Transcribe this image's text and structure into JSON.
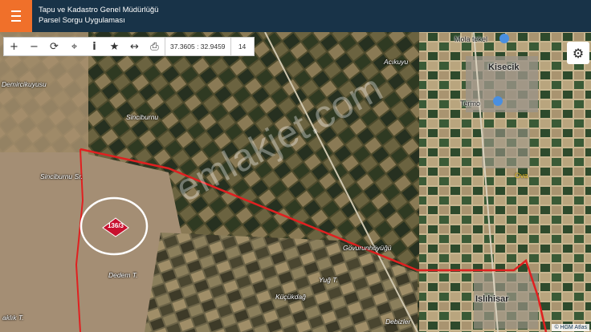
{
  "header": {
    "title_line1": "Tapu ve Kadastro Genel Müdürlüğü",
    "title_line2": "Parsel Sorgu Uygulaması",
    "menu_icon": "hamburger-icon"
  },
  "toolbar": {
    "icons": [
      "zoom-in-icon",
      "zoom-out-icon",
      "refresh-icon",
      "locate-icon",
      "info-icon",
      "favorite-icon",
      "measure-icon",
      "print-icon"
    ],
    "coordinates": "37.3605 : 32.9459",
    "zoom_level": "14"
  },
  "settings_icon": "gear-icon",
  "places": {
    "demircikuyusu": "Demircikuyusu",
    "acikuyu": "Acıkuyu",
    "kisecik": "Kisecik",
    "mola_tekel": "Mola tekel",
    "termo": "Termo",
    "sinciburnu": "Sinciburnu",
    "sinciburnu_sr": "Sinciburnu Sr.",
    "ova": "Ova",
    "govurunhoyugu": "Gövurunhöyüğü",
    "dedem": "Dedem T.",
    "yug": "Yuğ T.",
    "kucukdag": "Küçükdağ",
    "debizler": "Debizler",
    "isluhisar": "Islıhisar",
    "alik": "aklık T."
  },
  "parcel": {
    "label": "136/3",
    "color": "#c8102e"
  },
  "boundary_color": "#e02020",
  "watermark": "emlakjet.com",
  "attribution": "© HGM Atlas"
}
